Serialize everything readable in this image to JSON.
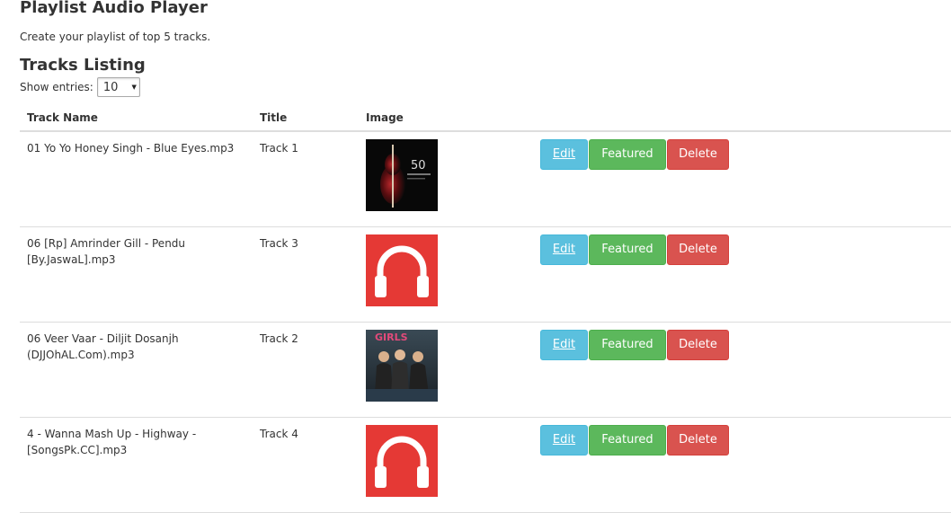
{
  "header": {
    "title": "Playlist Audio Player",
    "subtitle": "Create your playlist of top 5 tracks."
  },
  "listing": {
    "title": "Tracks Listing",
    "show_entries_label": "Show entries:",
    "entries_value": "10"
  },
  "table": {
    "columns": [
      "Track Name",
      "Title",
      "Image"
    ],
    "rows": [
      {
        "track_name": "01 Yo Yo Honey Singh - Blue Eyes.mp3",
        "title": "Track 1",
        "image": "dark-violin-album-cover"
      },
      {
        "track_name": "06 [Rp] Amrinder Gill - Pendu [By.JaswaL].mp3",
        "title": "Track 3",
        "image": "red-headphones-icon"
      },
      {
        "track_name": "06 Veer Vaar - Diljit Dosanjh (DJJOhAL.Com).mp3",
        "title": "Track 2",
        "image": "girls-album-cover"
      },
      {
        "track_name": "4 - Wanna Mash Up - Highway - [SongsPk.CC].mp3",
        "title": "Track 4",
        "image": "red-headphones-icon"
      }
    ]
  },
  "actions": {
    "edit": "Edit",
    "featured": "Featured",
    "delete": "Delete"
  },
  "colors": {
    "edit": "#5bc0de",
    "featured": "#5cb85c",
    "delete": "#d9534f",
    "headphones_bg": "#e53935"
  }
}
